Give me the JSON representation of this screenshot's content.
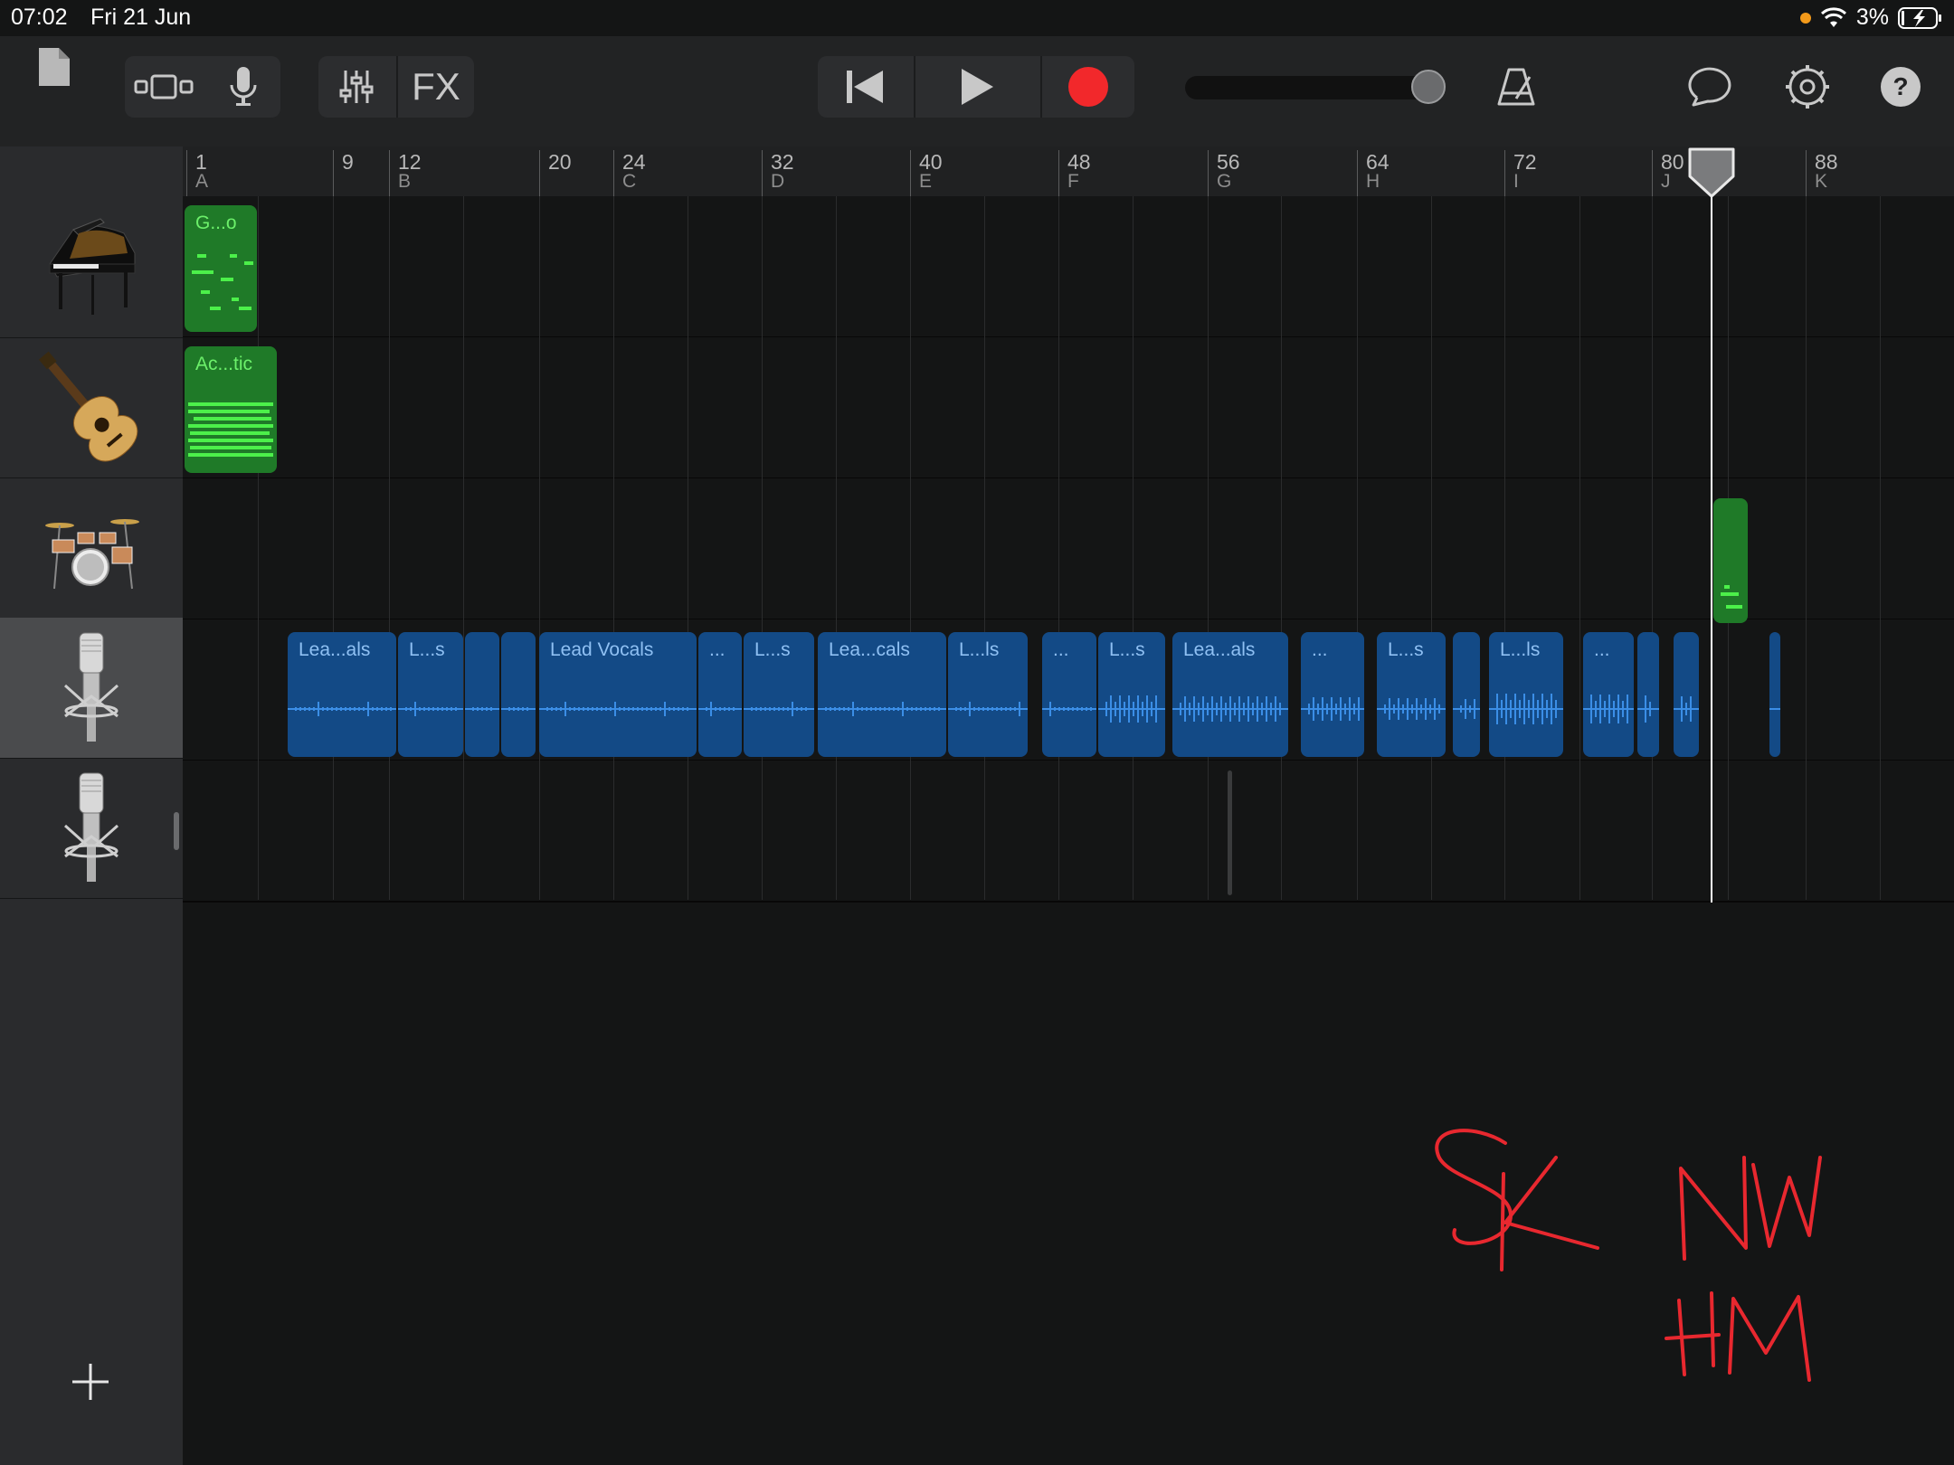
{
  "status_bar": {
    "time": "07:02",
    "date": "Fri 21 Jun",
    "battery": "3%"
  },
  "toolbar": {
    "fx_label": "FX",
    "icons": [
      "document-icon",
      "loop-browser-icon",
      "microphone-icon",
      "mixer-icon",
      "fx-button",
      "skip-back-icon",
      "play-icon",
      "record-icon",
      "master-volume-slider",
      "metronome-icon",
      "loop-icon",
      "settings-icon",
      "help-icon"
    ],
    "master_volume_level": 0.95
  },
  "ruler": {
    "markers": [
      {
        "num": "1",
        "sec": "A"
      },
      {
        "num": "9",
        "sec": ""
      },
      {
        "num": "12",
        "sec": "B"
      },
      {
        "num": "20",
        "sec": ""
      },
      {
        "num": "24",
        "sec": "C"
      },
      {
        "num": "32",
        "sec": "D"
      },
      {
        "num": "40",
        "sec": "E"
      },
      {
        "num": "48",
        "sec": "F"
      },
      {
        "num": "56",
        "sec": "G"
      },
      {
        "num": "64",
        "sec": "H"
      },
      {
        "num": "72",
        "sec": "I"
      },
      {
        "num": "80",
        "sec": "J"
      },
      {
        "num": "88",
        "sec": "K"
      }
    ]
  },
  "tracks": [
    {
      "instrument": "grand-piano-icon",
      "regions": [
        {
          "label": "G...o",
          "type": "midi"
        }
      ]
    },
    {
      "instrument": "acoustic-guitar-icon",
      "regions": [
        {
          "label": "Ac...tic",
          "type": "midi"
        }
      ]
    },
    {
      "instrument": "drum-kit-icon",
      "regions": [
        {
          "label": "",
          "type": "midi"
        }
      ]
    },
    {
      "instrument": "microphone-icon",
      "selected": true,
      "regions": [
        {
          "label": "Lea...als",
          "type": "audio"
        },
        {
          "label": "L...s",
          "type": "audio"
        },
        {
          "label": "",
          "type": "audio"
        },
        {
          "label": "",
          "type": "audio"
        },
        {
          "label": "Lead Vocals",
          "type": "audio"
        },
        {
          "label": "...",
          "type": "audio"
        },
        {
          "label": "L...s",
          "type": "audio"
        },
        {
          "label": "Lea...cals",
          "type": "audio"
        },
        {
          "label": "L...ls",
          "type": "audio"
        },
        {
          "label": "...",
          "type": "audio"
        },
        {
          "label": "L...s",
          "type": "audio"
        },
        {
          "label": "Lea...als",
          "type": "audio"
        },
        {
          "label": "...",
          "type": "audio"
        },
        {
          "label": "L...s",
          "type": "audio"
        },
        {
          "label": "",
          "type": "audio"
        },
        {
          "label": "L...ls",
          "type": "audio"
        },
        {
          "label": "...",
          "type": "audio"
        },
        {
          "label": "",
          "type": "audio"
        },
        {
          "label": "",
          "type": "audio"
        },
        {
          "label": "",
          "type": "audio"
        }
      ]
    },
    {
      "instrument": "microphone-icon",
      "regions": []
    }
  ],
  "handwriting": [
    "SK",
    "NW",
    "HM"
  ],
  "colors": {
    "midi_region": "#1f7a28",
    "audio_region": "#134a86",
    "record": "#f2282b",
    "ink": "#e8282f"
  }
}
